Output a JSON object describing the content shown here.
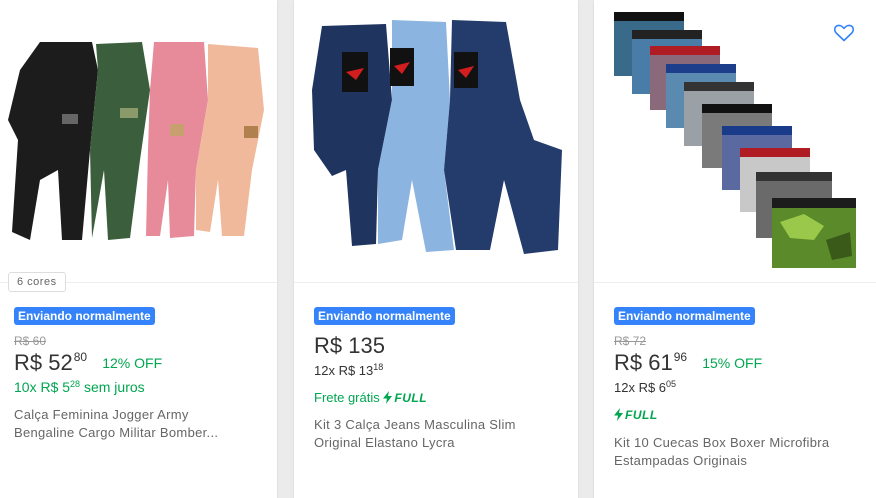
{
  "products": [
    {
      "colors_tag": "6 cores",
      "shipping_badge": "Enviando normalmente",
      "old_price": "R$ 60",
      "price_prefix": "R$",
      "price_int": "52",
      "price_cents": "80",
      "discount": "12% OFF",
      "installments_prefix": "10x R$ 5",
      "installments_cents": "28",
      "installments_suffix": "sem juros",
      "title_line1": "Calça Feminina Jogger Army",
      "title_line2": "Bengaline Cargo Militar Bomber..."
    },
    {
      "shipping_badge": "Enviando normalmente",
      "price_prefix": "R$",
      "price_int": "135",
      "installments_prefix": "12x R$ 13",
      "installments_cents": "18",
      "shipping_text": "Frete grátis",
      "full_label": "FULL",
      "title_line1": "Kit 3 Calça Jeans Masculina Slim",
      "title_line2": "Original Elastano Lycra"
    },
    {
      "shipping_badge": "Enviando normalmente",
      "old_price": "R$ 72",
      "price_prefix": "R$",
      "price_int": "61",
      "price_cents": "96",
      "discount": "15% OFF",
      "installments_prefix": "12x R$ 6",
      "installments_cents": "05",
      "full_label": "FULL",
      "title_line1": "Kit 10 Cuecas Box Boxer Microfibra",
      "title_line2": "Estampadas Originais",
      "favorite_icon": "heart-icon"
    }
  ],
  "colors": {
    "accent": "#3483fa",
    "green": "#00a650"
  }
}
